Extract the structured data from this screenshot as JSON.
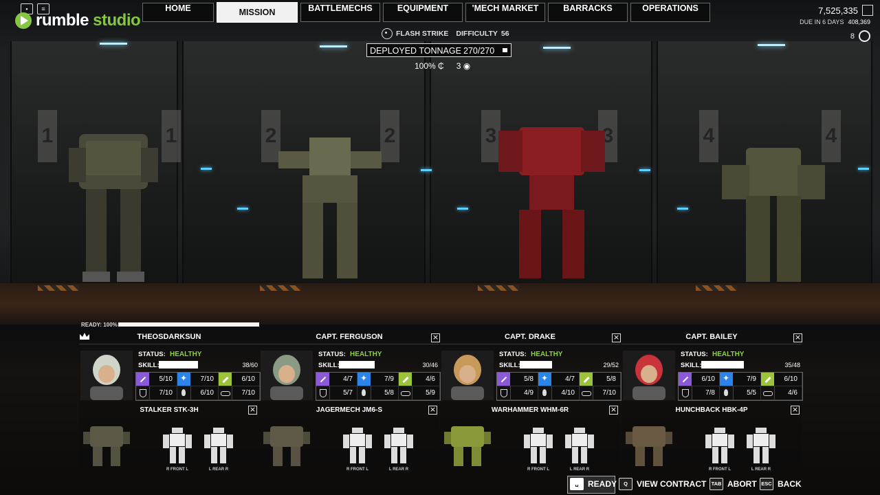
{
  "brand": {
    "name_a": "rumble",
    "name_b": " studio"
  },
  "nav": {
    "tabs": [
      {
        "label": "HOME",
        "active": false
      },
      {
        "label": "MISSION",
        "active": true
      },
      {
        "label": "BATTLEMECHS",
        "active": false
      },
      {
        "label": "EQUIPMENT",
        "active": false
      },
      {
        "label": "'MECH MARKET",
        "active": false
      },
      {
        "label": "BARRACKS",
        "active": false
      },
      {
        "label": "OPERATIONS",
        "active": false
      }
    ]
  },
  "finance": {
    "funds": "7,525,335",
    "due_label": "DUE IN 6 DAYS",
    "due_amount": "408,369",
    "pilot_count": "8"
  },
  "mission": {
    "name": "FLASH STRIKE",
    "difficulty_label": "DIFFICULTY",
    "difficulty": "56",
    "tonnage_label": "DEPLOYED TONNAGE",
    "tonnage": "270/270",
    "credits_pct": "100%",
    "salvage": "3"
  },
  "bays": [
    "1",
    "1",
    "2",
    "2",
    "3",
    "3",
    "4",
    "4"
  ],
  "lance": {
    "ready_label": "READY: 100%",
    "ready_fraction": 1.0,
    "slots": [
      {
        "pilot": "THEOSDARKSUN",
        "commander": true,
        "removable": false,
        "status_label": "STATUS:",
        "status": "HEALTHY",
        "skill_label": "SKILL:",
        "skill": "38/60",
        "skill_fraction": 0.55,
        "attrs": [
          "5/10",
          "7/10",
          "6/10",
          "7/10",
          "6/10",
          "7/10"
        ],
        "mech": "STALKER STK-3H",
        "paper_left": "R FRONT L",
        "paper_right": "L REAR R",
        "mech_color": "#5c5a46",
        "portrait_color": "#cfd4c8"
      },
      {
        "pilot": "CAPT. FERGUSON",
        "commander": false,
        "removable": true,
        "status_label": "STATUS:",
        "status": "HEALTHY",
        "skill_label": "SKILL:",
        "skill": "30/46",
        "skill_fraction": 0.5,
        "attrs": [
          "4/7",
          "7/9",
          "4/6",
          "5/7",
          "5/8",
          "5/9"
        ],
        "mech": "JAGERMECH JM6-S",
        "paper_left": "R FRONT L",
        "paper_right": "L REAR R",
        "mech_color": "#5f5a48",
        "portrait_color": "#8a9a84"
      },
      {
        "pilot": "CAPT. DRAKE",
        "commander": false,
        "removable": true,
        "status_label": "STATUS:",
        "status": "HEALTHY",
        "skill_label": "SKILL:",
        "skill": "29/52",
        "skill_fraction": 0.45,
        "attrs": [
          "5/8",
          "4/7",
          "5/8",
          "4/9",
          "4/10",
          "7/10"
        ],
        "mech": "WARHAMMER WHM-6R",
        "paper_left": "R FRONT L",
        "paper_right": "L REAR R",
        "mech_color": "#8a9a3a",
        "portrait_color": "#c89a5a"
      },
      {
        "pilot": "CAPT. BAILEY",
        "commander": false,
        "removable": true,
        "status_label": "STATUS:",
        "status": "HEALTHY",
        "skill_label": "SKILL:",
        "skill": "35/48",
        "skill_fraction": 0.6,
        "attrs": [
          "6/10",
          "7/9",
          "6/10",
          "7/8",
          "5/5",
          "4/6"
        ],
        "mech": "HUNCHBACK HBK-4P",
        "paper_left": "R FRONT L",
        "paper_right": "L REAR R",
        "mech_color": "#6a5a44",
        "portrait_color": "#c8343a"
      }
    ]
  },
  "actions": [
    {
      "key": "␣",
      "label": "READY"
    },
    {
      "key": "Q",
      "label": "VIEW CONTRACT"
    },
    {
      "key": "TAB",
      "label": "ABORT"
    },
    {
      "key": "ESC",
      "label": "BACK"
    }
  ]
}
